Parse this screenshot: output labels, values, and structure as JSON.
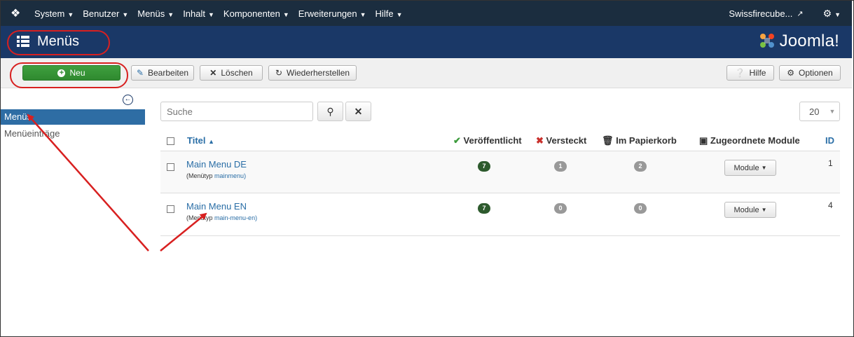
{
  "navbar": {
    "menu": [
      "System",
      "Benutzer",
      "Menüs",
      "Inhalt",
      "Komponenten",
      "Erweiterungen",
      "Hilfe"
    ],
    "site": "Swissfirecube..."
  },
  "header": {
    "title": "Menüs",
    "brand": "Joomla!"
  },
  "toolbar": {
    "new": "Neu",
    "edit": "Bearbeiten",
    "delete": "Löschen",
    "rebuild": "Wiederherstellen",
    "help": "Hilfe",
    "options": "Optionen"
  },
  "sidebar": {
    "items": [
      "Menüs",
      "Menüeinträge"
    ]
  },
  "filter": {
    "search_placeholder": "Suche",
    "limit": "20"
  },
  "table": {
    "headers": {
      "title": "Titel",
      "published": "Veröffentlicht",
      "unpublished": "Versteckt",
      "trashed": "Im Papierkorb",
      "modules": "Zugeordnete Module",
      "id": "ID"
    },
    "rows": [
      {
        "title": "Main Menu DE",
        "menutype_label": "(Menütyp",
        "menutype": "mainmenu)",
        "published": "7",
        "unpublished": "1",
        "trashed": "2",
        "modules": "Module",
        "id": "1"
      },
      {
        "title": "Main Menu EN",
        "menutype_label": "(Menütyp",
        "menutype": "main-menu-en)",
        "published": "7",
        "unpublished": "0",
        "trashed": "0",
        "modules": "Module",
        "id": "4"
      }
    ]
  },
  "colors": {
    "navbar": "#1b2d3f",
    "header": "#1a3867",
    "new_button": "#2f892f",
    "annotation": "#d82020"
  }
}
